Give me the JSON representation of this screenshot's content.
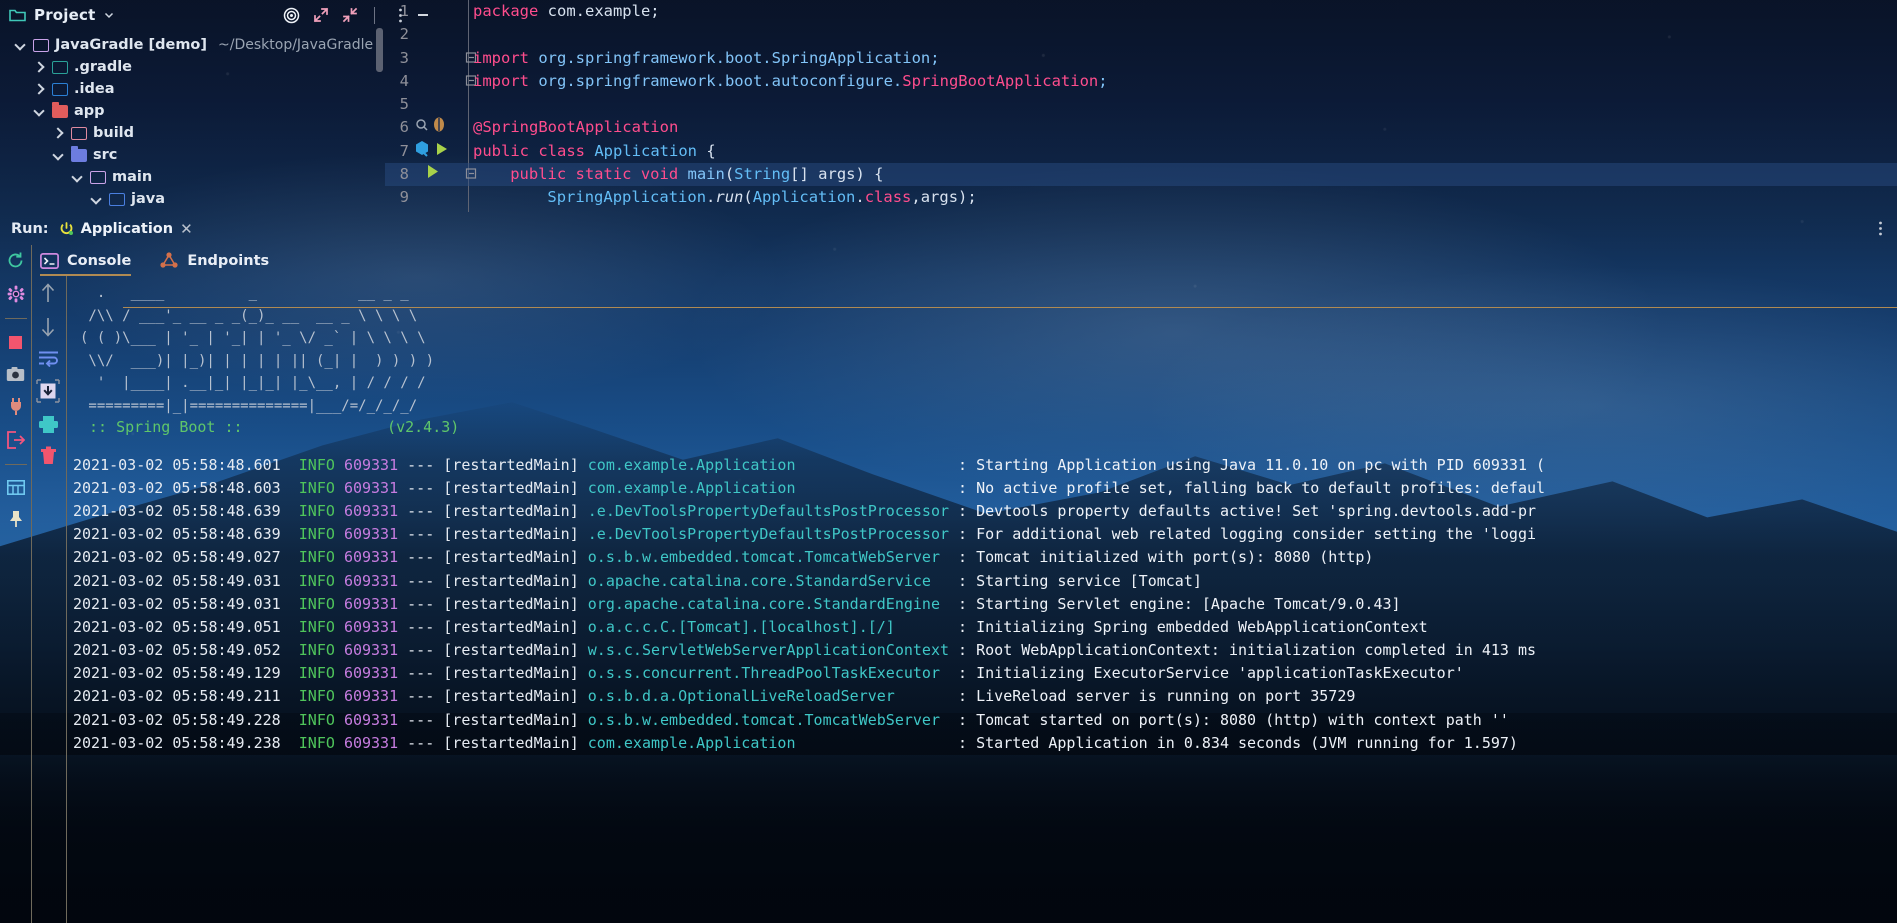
{
  "project_panel": {
    "title": "Project",
    "title_chevron": "chevron-down",
    "toolbar_icons": [
      "target-icon",
      "expand-icon",
      "collapse-icon"
    ],
    "tree": [
      {
        "label": "JavaGradle [demo]",
        "path": "~/Desktop/JavaGradle",
        "indent": 0,
        "arrow": "down",
        "icon": "folder",
        "color": "#c9a3e8"
      },
      {
        "label": ".gradle",
        "path": "",
        "indent": 1,
        "arrow": "right",
        "icon": "folder",
        "color": "#2aa198"
      },
      {
        "label": ".idea",
        "path": "",
        "indent": 1,
        "arrow": "right",
        "icon": "folder",
        "color": "#2b7fd4"
      },
      {
        "label": "app",
        "path": "",
        "indent": 1,
        "arrow": "down",
        "icon": "module",
        "color": "#e05c5c"
      },
      {
        "label": "build",
        "path": "",
        "indent": 2,
        "arrow": "right",
        "icon": "folder",
        "color": "#e08ba0"
      },
      {
        "label": "src",
        "path": "",
        "indent": 2,
        "arrow": "down",
        "icon": "source",
        "color": "#6d7de0"
      },
      {
        "label": "main",
        "path": "",
        "indent": 3,
        "arrow": "down",
        "icon": "folder",
        "color": "#c9a3e8"
      },
      {
        "label": "java",
        "path": "",
        "indent": 4,
        "arrow": "down",
        "icon": "folder",
        "color": "#4a7fe0"
      }
    ]
  },
  "editor": {
    "gutter_icons": [
      "more-vertical-icon",
      "minimize-icon"
    ],
    "lines": [
      {
        "num": "1",
        "indent": 0,
        "highlight": false,
        "fold": "",
        "gutter": "",
        "tokens": [
          {
            "t": "package ",
            "c": "kw"
          },
          {
            "t": "com.example;",
            "c": "pl"
          }
        ]
      },
      {
        "num": "2",
        "indent": 0,
        "highlight": false,
        "fold": "",
        "gutter": "",
        "tokens": []
      },
      {
        "num": "3",
        "indent": 0,
        "highlight": false,
        "fold": "minus",
        "gutter": "",
        "tokens": [
          {
            "t": "import ",
            "c": "kw"
          },
          {
            "t": "org.springframework.boot.SpringApplication;",
            "c": "id"
          }
        ]
      },
      {
        "num": "4",
        "indent": 0,
        "highlight": false,
        "fold": "minus",
        "gutter": "",
        "tokens": [
          {
            "t": "import ",
            "c": "kw"
          },
          {
            "t": "org.springframework.boot.autoconfigure.",
            "c": "id"
          },
          {
            "t": "SpringBootApplication",
            "c": "ann"
          },
          {
            "t": ";",
            "c": "id"
          }
        ]
      },
      {
        "num": "5",
        "indent": 0,
        "highlight": false,
        "fold": "",
        "gutter": "",
        "tokens": []
      },
      {
        "num": "6",
        "indent": 0,
        "highlight": false,
        "fold": "",
        "gutter": "bean-search",
        "tokens": [
          {
            "t": "@SpringBootApplication",
            "c": "ann"
          }
        ]
      },
      {
        "num": "7",
        "indent": 0,
        "highlight": false,
        "fold": "",
        "gutter": "bean-run",
        "tokens": [
          {
            "t": "public class ",
            "c": "kw"
          },
          {
            "t": "Application",
            "c": "cls"
          },
          {
            "t": " {",
            "c": "pl"
          }
        ]
      },
      {
        "num": "8",
        "indent": 4,
        "highlight": true,
        "fold": "minus",
        "gutter": "run",
        "tokens": [
          {
            "t": "public static void ",
            "c": "kw"
          },
          {
            "t": "main",
            "c": "id"
          },
          {
            "t": "(",
            "c": "pl"
          },
          {
            "t": "String",
            "c": "cls"
          },
          {
            "t": "[] args) {",
            "c": "pl"
          }
        ]
      },
      {
        "num": "9",
        "indent": 8,
        "highlight": false,
        "fold": "",
        "gutter": "",
        "tokens": [
          {
            "t": "SpringApplication",
            "c": "cls"
          },
          {
            "t": ".",
            "c": "pl"
          },
          {
            "t": "run",
            "c": "ital pl"
          },
          {
            "t": "(",
            "c": "pl"
          },
          {
            "t": "Application",
            "c": "cls"
          },
          {
            "t": ".",
            "c": "pl"
          },
          {
            "t": "class",
            "c": "kw"
          },
          {
            "t": ",args);",
            "c": "pl"
          }
        ]
      }
    ]
  },
  "run_panel": {
    "label": "Run:",
    "config_name": "Application",
    "config_icon": "power-icon",
    "close_icon": "close-icon",
    "options_icon": "more-vertical-icon",
    "tabs": [
      {
        "label": "Console",
        "icon": "terminal-icon",
        "active": true
      },
      {
        "label": "Endpoints",
        "icon": "endpoints-icon",
        "active": false
      }
    ],
    "side_rail_icons": [
      "rerun-icon",
      "settings-icon",
      "stop-icon",
      "camera-icon",
      "plug-icon",
      "exit-icon",
      "layout-icon",
      "pin-icon"
    ],
    "console_rail_icons": [
      "scroll-up-icon",
      "scroll-down-icon",
      "soft-wrap-icon",
      "scroll-to-end-icon",
      "print-icon",
      "trash-icon"
    ]
  },
  "console": {
    "banner": [
      "  .   ____          _            __ _ _",
      " /\\\\ / ___'_ __ _ _(_)_ __  __ _ \\ \\ \\ \\",
      "( ( )\\___ | '_ | '_| | '_ \\/ _` | \\ \\ \\ \\",
      " \\\\/  ___)| |_)| | | | | || (_| |  ) ) ) )",
      "  '  |____| .__|_| |_|_| |_\\__, | / / / /",
      " =========|_|==============|___/=/_/_/_/"
    ],
    "banner_footer": " :: Spring Boot ::                (v2.4.3)",
    "log_lines": [
      {
        "ts": "2021-03-02 05:58:48.601",
        "level": "INFO",
        "pid": "609331",
        "thread": "restartedMain",
        "logger": "com.example.Application",
        "msg": "Starting Application using Java 11.0.10 on pc with PID 609331 ("
      },
      {
        "ts": "2021-03-02 05:58:48.603",
        "level": "INFO",
        "pid": "609331",
        "thread": "restartedMain",
        "logger": "com.example.Application",
        "msg": "No active profile set, falling back to default profiles: defaul"
      },
      {
        "ts": "2021-03-02 05:58:48.639",
        "level": "INFO",
        "pid": "609331",
        "thread": "restartedMain",
        "logger": ".e.DevToolsPropertyDefaultsPostProcessor",
        "msg": "Devtools property defaults active! Set 'spring.devtools.add-pr"
      },
      {
        "ts": "2021-03-02 05:58:48.639",
        "level": "INFO",
        "pid": "609331",
        "thread": "restartedMain",
        "logger": ".e.DevToolsPropertyDefaultsPostProcessor",
        "msg": "For additional web related logging consider setting the 'loggi"
      },
      {
        "ts": "2021-03-02 05:58:49.027",
        "level": "INFO",
        "pid": "609331",
        "thread": "restartedMain",
        "logger": "o.s.b.w.embedded.tomcat.TomcatWebServer",
        "msg": "Tomcat initialized with port(s): 8080 (http)"
      },
      {
        "ts": "2021-03-02 05:58:49.031",
        "level": "INFO",
        "pid": "609331",
        "thread": "restartedMain",
        "logger": "o.apache.catalina.core.StandardService",
        "msg": "Starting service [Tomcat]"
      },
      {
        "ts": "2021-03-02 05:58:49.031",
        "level": "INFO",
        "pid": "609331",
        "thread": "restartedMain",
        "logger": "org.apache.catalina.core.StandardEngine",
        "msg": "Starting Servlet engine: [Apache Tomcat/9.0.43]"
      },
      {
        "ts": "2021-03-02 05:58:49.051",
        "level": "INFO",
        "pid": "609331",
        "thread": "restartedMain",
        "logger": "o.a.c.c.C.[Tomcat].[localhost].[/]",
        "msg": "Initializing Spring embedded WebApplicationContext"
      },
      {
        "ts": "2021-03-02 05:58:49.052",
        "level": "INFO",
        "pid": "609331",
        "thread": "restartedMain",
        "logger": "w.s.c.ServletWebServerApplicationContext",
        "msg": "Root WebApplicationContext: initialization completed in 413 ms"
      },
      {
        "ts": "2021-03-02 05:58:49.129",
        "level": "INFO",
        "pid": "609331",
        "thread": "restartedMain",
        "logger": "o.s.s.concurrent.ThreadPoolTaskExecutor",
        "msg": "Initializing ExecutorService 'applicationTaskExecutor'"
      },
      {
        "ts": "2021-03-02 05:58:49.211",
        "level": "INFO",
        "pid": "609331",
        "thread": "restartedMain",
        "logger": "o.s.b.d.a.OptionalLiveReloadServer",
        "msg": "LiveReload server is running on port 35729"
      },
      {
        "ts": "2021-03-02 05:58:49.228",
        "level": "INFO",
        "pid": "609331",
        "thread": "restartedMain",
        "logger": "o.s.b.w.embedded.tomcat.TomcatWebServer",
        "msg": "Tomcat started on port(s): 8080 (http) with context path ''"
      },
      {
        "ts": "2021-03-02 05:58:49.238",
        "level": "INFO",
        "pid": "609331",
        "thread": "restartedMain",
        "logger": "com.example.Application",
        "msg": "Started Application in 0.834 seconds (JVM running for 1.597)"
      }
    ]
  },
  "colors": {
    "keyword": "#ff4d8d",
    "identifier": "#82c4f8",
    "log_level": "#4fc55b",
    "log_pid": "#c77ce0",
    "log_logger": "#3fc7c7",
    "tab_accent": "#b08a52"
  }
}
